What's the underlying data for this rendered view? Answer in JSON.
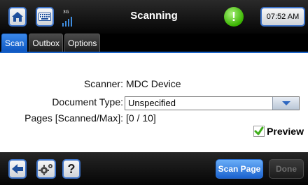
{
  "header": {
    "title": "Scanning",
    "time": "07:52 AM",
    "signal_label": "3G",
    "icons": [
      "home-icon",
      "keyboard-icon",
      "signal-icon",
      "alert-icon"
    ],
    "alert_glyph": "!"
  },
  "tabs": [
    {
      "label": "Scan",
      "active": true
    },
    {
      "label": "Outbox",
      "active": false
    },
    {
      "label": "Options",
      "active": false
    }
  ],
  "form": {
    "scanner_label": "Scanner:",
    "scanner_value": "MDC Device",
    "doctype_label": "Document Type:",
    "doctype_value": "Unspecified",
    "pages_label": "Pages [Scanned/Max]:",
    "pages_value": "[0 / 10]",
    "preview_label": "Preview",
    "preview_checked": true
  },
  "footer": {
    "help_label": "?",
    "scan_label": "Scan Page",
    "done_label": "Done",
    "icons": [
      "back-arrow-icon",
      "gear-icon",
      "help-icon"
    ]
  },
  "colors": {
    "accent": "#1b63cf",
    "tab_active": "#3a88ea",
    "alert": "#39b400",
    "check": "#3fae1a"
  }
}
